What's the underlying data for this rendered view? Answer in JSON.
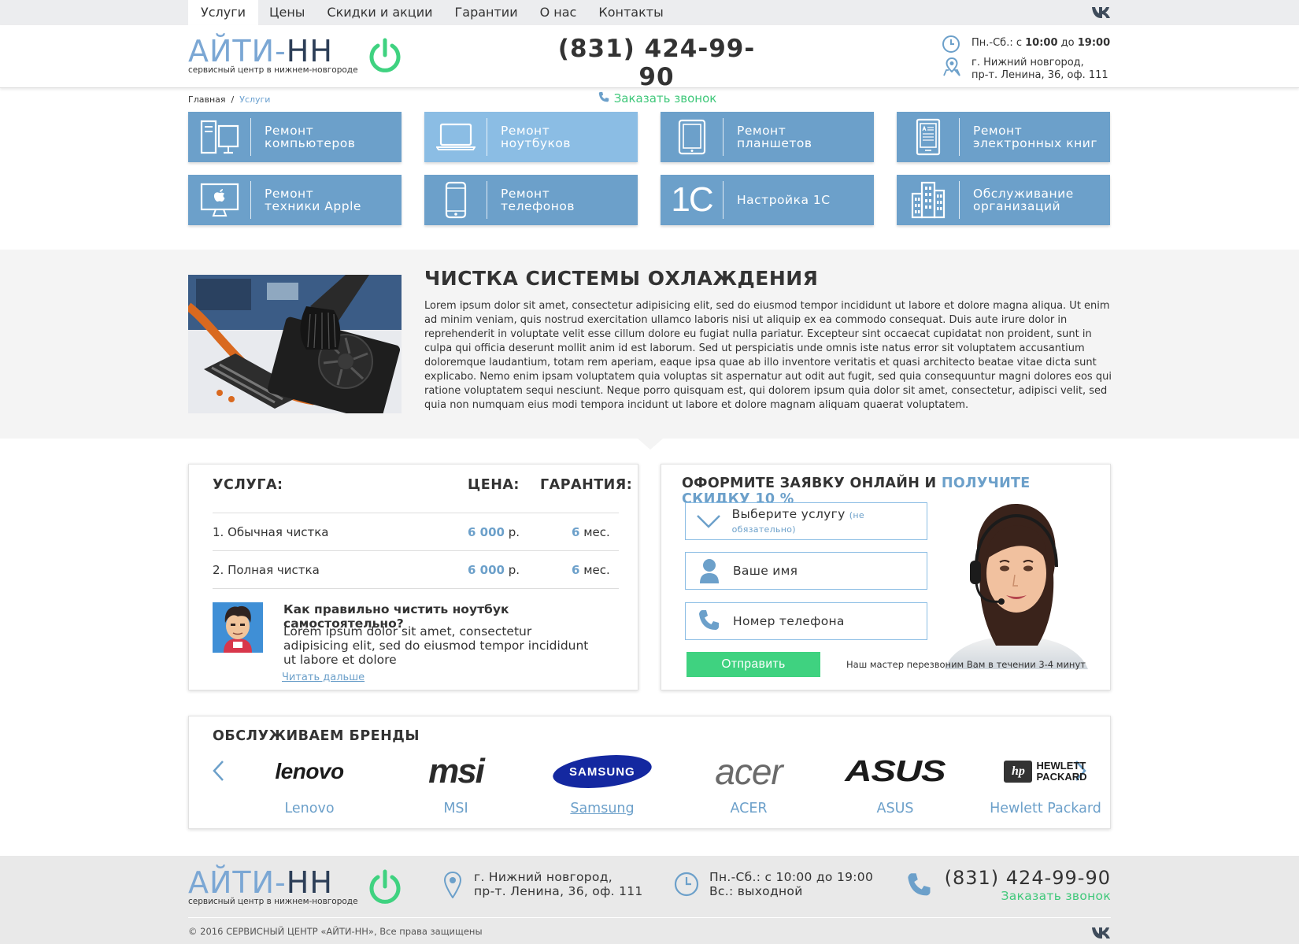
{
  "topnav": {
    "items": [
      "Услуги",
      "Цены",
      "Скидки и акции",
      "Гарантии",
      "О нас",
      "Контакты"
    ],
    "active": "Услуги"
  },
  "header": {
    "logo_part1": "АЙТИ-",
    "logo_part2": "НН",
    "logo_sub": "сервисный центр в нижнем-новгороде",
    "phone": "(831) 424-99-90",
    "callback": "Заказать звонок",
    "hours_prefix": "Пн.-Сб.: с ",
    "hours_from": "10:00",
    "hours_mid": " до ",
    "hours_to": "19:00",
    "address_line1": "г. Нижний новгород,",
    "address_line2": "пр-т. Ленина, 36, оф. 111"
  },
  "breadcrumb": {
    "home": "Главная",
    "sep": "/",
    "current": "Услуги"
  },
  "services": [
    {
      "line1": "Ремонт",
      "line2": "компьютеров",
      "icon": "computer-icon"
    },
    {
      "line1": "Ремонт",
      "line2": "ноутбуков",
      "icon": "laptop-icon"
    },
    {
      "line1": "Ремонт",
      "line2": "планшетов",
      "icon": "tablet-icon"
    },
    {
      "line1": "Ремонт",
      "line2": "электронных книг",
      "icon": "ebook-icon"
    },
    {
      "line1": "Ремонт",
      "line2": "техники Apple",
      "icon": "apple-icon"
    },
    {
      "line1": "Ремонт",
      "line2": "телефонов",
      "icon": "phone-icon"
    },
    {
      "line1": "Настройка 1С",
      "line2": "",
      "icon": "1c-icon",
      "icon_text": "1С"
    },
    {
      "line1": "Обслуживание",
      "line2": "организаций",
      "icon": "building-icon"
    }
  ],
  "article": {
    "title": "ЧИСТКА СИСТЕМЫ ОХЛАЖДЕНИЯ",
    "body": "Lorem ipsum dolor sit amet, consectetur adipisicing elit, sed do eiusmod tempor incididunt ut labore et dolore magna aliqua. Ut enim ad minim veniam, quis nostrud exercitation ullamco laboris nisi ut aliquip ex ea commodo consequat. Duis aute irure dolor in reprehenderit in voluptate velit esse cillum dolore eu fugiat nulla pariatur. Excepteur sint occaecat cupidatat non proident, sunt in culpa qui officia deserunt mollit anim id est laborum. Sed ut perspiciatis unde omnis iste natus error sit voluptatem accusantium doloremque laudantium, totam rem aperiam, eaque ipsa quae ab illo inventore veritatis et quasi architecto beatae vitae dicta sunt explicabo. Nemo enim ipsam voluptatem quia voluptas sit aspernatur aut odit aut fugit, sed quia consequuntur magni dolores eos qui ratione voluptatem sequi nesciunt. Neque porro quisquam est, qui dolorem ipsum quia dolor sit amet, consectetur, adipisci velit, sed quia non numquam eius modi tempora incidunt ut labore et dolore magnam aliquam quaerat voluptatem."
  },
  "price": {
    "col_service": "УСЛУГА:",
    "col_price": "ЦЕНА:",
    "col_warranty": "ГАРАНТИЯ:",
    "rows": [
      {
        "name": "1. Обычная чистка",
        "price": "6 000",
        "currency": " р.",
        "warranty": "6",
        "unit": " мес."
      },
      {
        "name": "2. Полная чистка",
        "price": "6 000",
        "currency": " р.",
        "warranty": "6",
        "unit": " мес."
      }
    ],
    "tip_title": "Как правильно чистить ноутбук самостоятельно?",
    "tip_body": "Lorem ipsum dolor sit amet, consectetur adipisicing elit, sed do eiusmod tempor incididunt ut labore et dolore",
    "tip_more": "Читать дальше"
  },
  "order": {
    "title_part1": "ОФОРМИТЕ ЗАЯВКУ ОНЛАЙН И ",
    "title_part2": "ПОЛУЧИТЕ СКИДКУ 10 %",
    "select_label": "Выберите услугу",
    "select_hint": "(не обязательно)",
    "name_placeholder": "Ваше имя",
    "phone_placeholder": "Номер телефона",
    "submit": "Отправить",
    "note": "Наш мастер перезвоним Вам в течении 3-4 минут"
  },
  "brands": {
    "title": "ОБСЛУЖИВАЕМ БРЕНДЫ",
    "items": [
      {
        "name": "Lenovo",
        "logo": "lenovo"
      },
      {
        "name": "MSI",
        "logo": "msi"
      },
      {
        "name": "Samsung",
        "logo": "SAMSUNG"
      },
      {
        "name": "ACER",
        "logo": "acer"
      },
      {
        "name": "ASUS",
        "logo": "ASUS"
      },
      {
        "name": "Hewlett Packard",
        "logo_line1": "HEWLETT",
        "logo_line2": "PACKARD",
        "logo_badge": "hp"
      }
    ]
  },
  "footer": {
    "address_line1": "г. Нижний новгород,",
    "address_line2": "пр-т. Ленина, 36, оф. 111",
    "hours_line1": "Пн.-Сб.: с 10:00 до 19:00",
    "hours_line2": "Вс.: выходной",
    "phone": "(831) 424-99-90",
    "callback": "Заказать звонок",
    "copyright": "© 2016 СЕРВИСНЫЙ ЦЕНТР «АЙТИ-НН», Все права защищены"
  },
  "colors": {
    "accent": "#6ca0ca",
    "accent_light": "#8bbde4",
    "green": "#3fd280",
    "band": "#f4f4f4"
  }
}
